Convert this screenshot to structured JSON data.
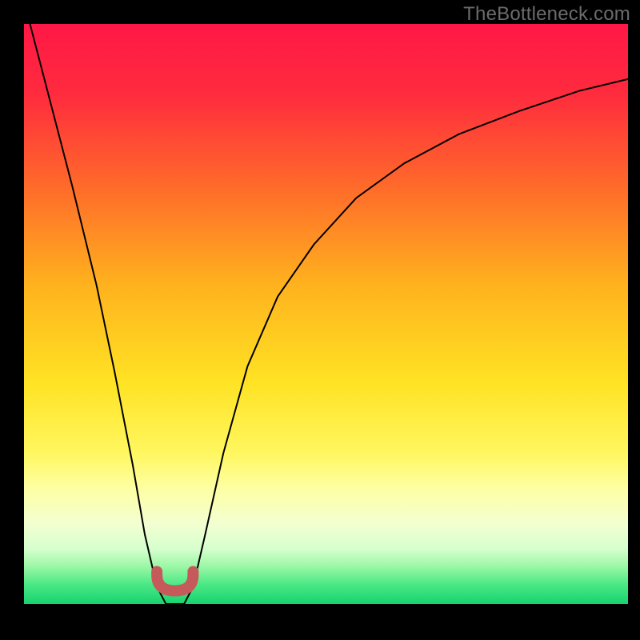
{
  "watermark": "TheBottleneck.com",
  "chart_data": {
    "type": "line",
    "title": "",
    "xlabel": "",
    "ylabel": "",
    "xlim": [
      0,
      100
    ],
    "ylim": [
      0,
      100
    ],
    "gradient_stops": [
      {
        "pos": 0.0,
        "color": "#ff1846"
      },
      {
        "pos": 0.12,
        "color": "#ff2b3e"
      },
      {
        "pos": 0.28,
        "color": "#ff6a2a"
      },
      {
        "pos": 0.45,
        "color": "#ffb21e"
      },
      {
        "pos": 0.62,
        "color": "#ffe324"
      },
      {
        "pos": 0.74,
        "color": "#fff760"
      },
      {
        "pos": 0.8,
        "color": "#feffa2"
      },
      {
        "pos": 0.86,
        "color": "#f4ffd0"
      },
      {
        "pos": 0.905,
        "color": "#d6ffce"
      },
      {
        "pos": 0.935,
        "color": "#9cf7a6"
      },
      {
        "pos": 0.965,
        "color": "#4de987"
      },
      {
        "pos": 1.0,
        "color": "#17d36f"
      }
    ],
    "green_band_y": [
      93,
      100
    ],
    "series": [
      {
        "name": "bottleneck-curve",
        "x": [
          1,
          4,
          8,
          12,
          15,
          18,
          20,
          22,
          23.5,
          25,
          26.5,
          28,
          30,
          33,
          37,
          42,
          48,
          55,
          63,
          72,
          82,
          92,
          100
        ],
        "y": [
          100,
          88,
          72,
          55,
          40,
          24,
          12,
          3,
          0,
          0,
          0,
          3,
          12,
          26,
          41,
          53,
          62,
          70,
          76,
          81,
          85,
          88.5,
          90.5
        ]
      }
    ],
    "valley_marker": {
      "color": "#c65a5a",
      "thickness_px": 14,
      "x_range": [
        22,
        28
      ],
      "y_approx": 0
    }
  }
}
